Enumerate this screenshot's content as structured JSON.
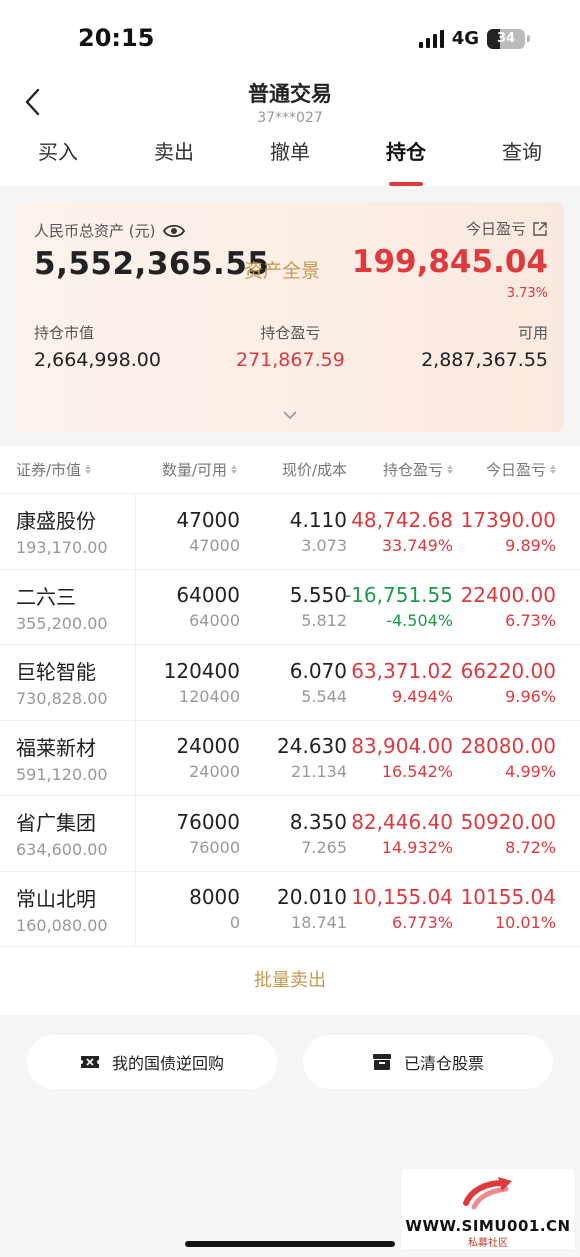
{
  "status": {
    "time": "20:15",
    "network": "4G",
    "battery": "34"
  },
  "header": {
    "title": "普通交易",
    "account": "37***027"
  },
  "tabs": [
    {
      "label": "买入"
    },
    {
      "label": "卖出"
    },
    {
      "label": "撤单"
    },
    {
      "label": "持仓",
      "active": true
    },
    {
      "label": "查询"
    }
  ],
  "summary": {
    "total_label": "人民币总资产 (元)",
    "total_value": "5,552,365.55",
    "overview_link": "资产全景",
    "today_label": "今日盈亏",
    "today_value": "199,845.04",
    "today_pct": "3.73%",
    "market_value_label": "持仓市值",
    "market_value": "2,664,998.00",
    "position_pl_label": "持仓盈亏",
    "position_pl": "271,867.59",
    "available_label": "可用",
    "available": "2,887,367.55"
  },
  "table": {
    "headers": [
      "证券/市值",
      "数量/可用",
      "现价/成本",
      "持仓盈亏",
      "今日盈亏"
    ],
    "rows": [
      {
        "name": "康盛股份",
        "mv": "193,170.00",
        "qty": "47000",
        "avail": "47000",
        "price": "4.110",
        "cost": "3.073",
        "pl": "48,742.68",
        "pl_pct": "33.749%",
        "today": "17390.00",
        "today_pct": "9.89%",
        "pl_sign": "pos"
      },
      {
        "name": "二六三",
        "mv": "355,200.00",
        "qty": "64000",
        "avail": "64000",
        "price": "5.550",
        "cost": "5.812",
        "pl": "-16,751.55",
        "pl_pct": "-4.504%",
        "today": "22400.00",
        "today_pct": "6.73%",
        "pl_sign": "neg"
      },
      {
        "name": "巨轮智能",
        "mv": "730,828.00",
        "qty": "120400",
        "avail": "120400",
        "price": "6.070",
        "cost": "5.544",
        "pl": "63,371.02",
        "pl_pct": "9.494%",
        "today": "66220.00",
        "today_pct": "9.96%",
        "pl_sign": "pos"
      },
      {
        "name": "福莱新材",
        "mv": "591,120.00",
        "qty": "24000",
        "avail": "24000",
        "price": "24.630",
        "cost": "21.134",
        "pl": "83,904.00",
        "pl_pct": "16.542%",
        "today": "28080.00",
        "today_pct": "4.99%",
        "pl_sign": "pos"
      },
      {
        "name": "省广集团",
        "mv": "634,600.00",
        "qty": "76000",
        "avail": "76000",
        "price": "8.350",
        "cost": "7.265",
        "pl": "82,446.40",
        "pl_pct": "14.932%",
        "today": "50920.00",
        "today_pct": "8.72%",
        "pl_sign": "pos"
      },
      {
        "name": "常山北明",
        "mv": "160,080.00",
        "qty": "8000",
        "avail": "0",
        "price": "20.010",
        "cost": "18.741",
        "pl": "10,155.04",
        "pl_pct": "6.773%",
        "today": "10155.04",
        "today_pct": "10.01%",
        "pl_sign": "pos"
      }
    ]
  },
  "batch_sell": "批量卖出",
  "buttons": {
    "repo": "我的国债逆回购",
    "cleared": "已清仓股票"
  },
  "watermark": {
    "url": "WWW.SIMU001.CN",
    "sub": "私募社区"
  },
  "colors": {
    "red": "#e0393d",
    "green": "#1f9a4a",
    "gold": "#c79a52"
  }
}
